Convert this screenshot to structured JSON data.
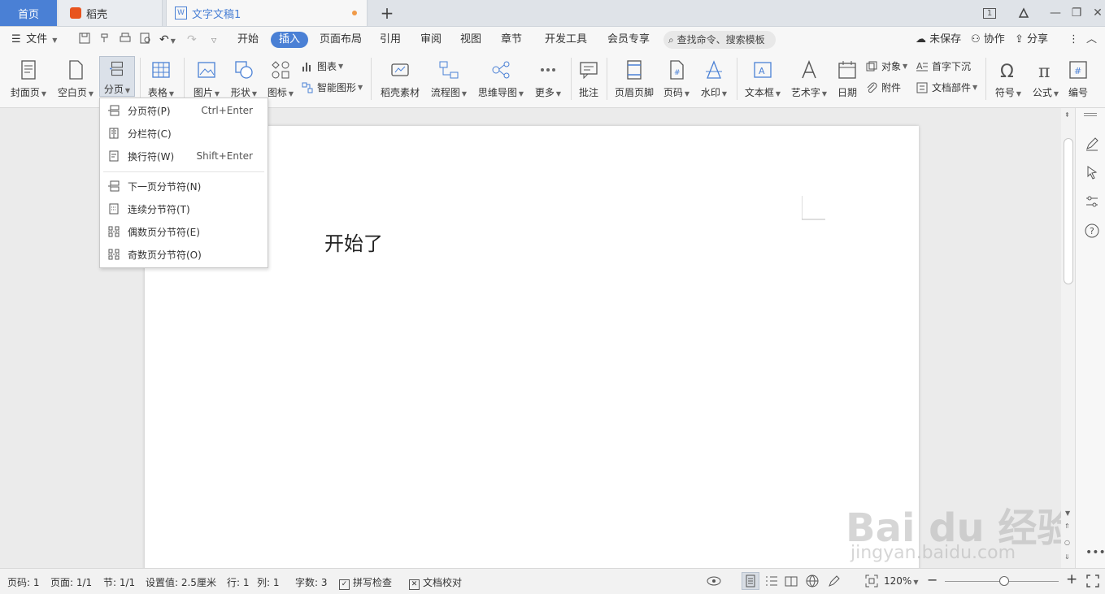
{
  "tabs": {
    "home": "首页",
    "daoke": "稻壳",
    "doc": "文字文稿1",
    "add": "+"
  },
  "window": {
    "page_indicator": "1",
    "minimize": "—",
    "restore": "❐",
    "close": "✕"
  },
  "menu": {
    "file": "文件",
    "items": [
      "开始",
      "插入",
      "页面布局",
      "引用",
      "审阅",
      "视图",
      "章节",
      "开发工具",
      "会员专享"
    ],
    "search_placeholder": "查找命令、搜索模板",
    "unsaved": "未保存",
    "collab": "协作",
    "share": "分享"
  },
  "ribbon": {
    "cover": "封面页",
    "blank": "空白页",
    "pagebreak": "分页",
    "table": "表格",
    "picture": "图片",
    "shape": "形状",
    "icon": "图标",
    "chart": "图表",
    "smartart": "智能图形",
    "daoke_material": "稻壳素材",
    "flowchart": "流程图",
    "mindmap": "思维导图",
    "more": "更多",
    "comment": "批注",
    "header_footer": "页眉页脚",
    "page_number": "页码",
    "watermark": "水印",
    "textbox": "文本框",
    "wordart": "艺术字",
    "date": "日期",
    "object": "对象",
    "attachment": "附件",
    "dropcap": "首字下沉",
    "docpart": "文档部件",
    "symbol": "符号",
    "formula": "公式",
    "numbering": "编号"
  },
  "dropdown": {
    "items": [
      {
        "label": "分页符(P)",
        "shortcut": "Ctrl+Enter"
      },
      {
        "label": "分栏符(C)",
        "shortcut": ""
      },
      {
        "label": "换行符(W)",
        "shortcut": "Shift+Enter"
      },
      {
        "label": "下一页分节符(N)",
        "shortcut": ""
      },
      {
        "label": "连续分节符(T)",
        "shortcut": ""
      },
      {
        "label": "偶数页分节符(E)",
        "shortcut": ""
      },
      {
        "label": "奇数页分节符(O)",
        "shortcut": ""
      }
    ]
  },
  "document": {
    "text": "开始了"
  },
  "status": {
    "page_code": "页码: 1",
    "page": "页面: 1/1",
    "section": "节: 1/1",
    "setting": "设置值: 2.5厘米",
    "row": "行: 1",
    "col": "列: 1",
    "word_count": "字数: 3",
    "spellcheck": "拼写检查",
    "proofread": "文档校对",
    "zoom": "120%"
  },
  "watermark": {
    "brand": "Bai du 经验",
    "url": "jingyan.baidu.com"
  },
  "colors": {
    "accent": "#4a80d5",
    "modified_dot": "#f09a48"
  }
}
